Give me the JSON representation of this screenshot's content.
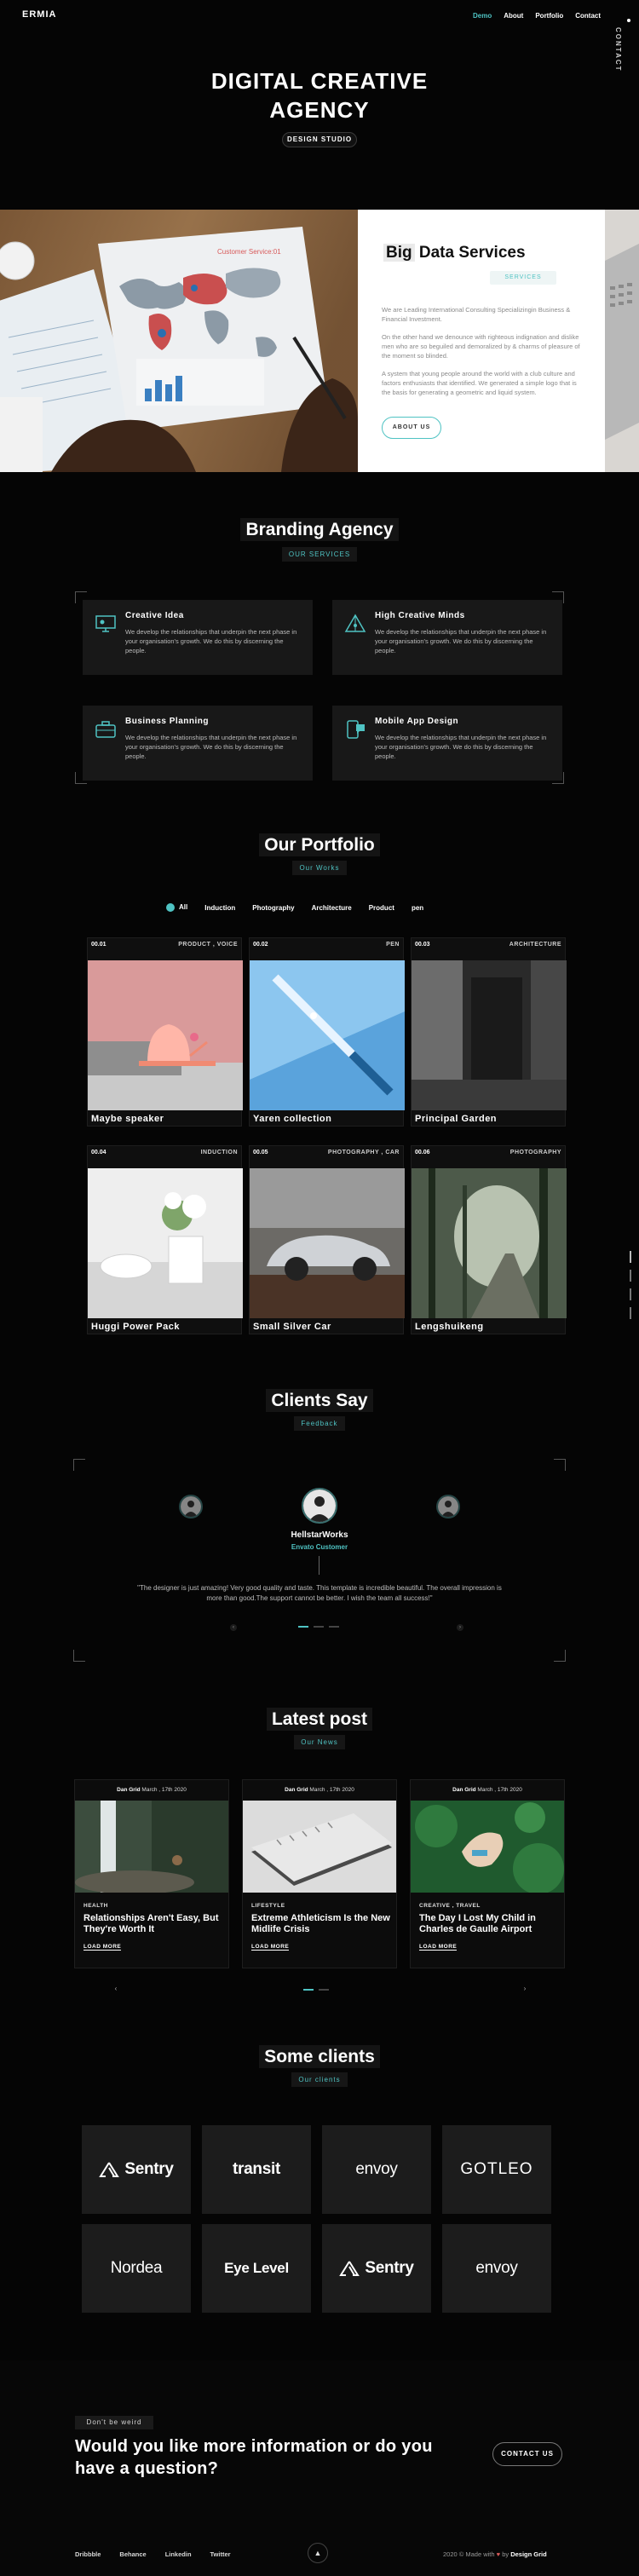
{
  "nav": {
    "logo": "ERMIA",
    "links": [
      "Demo",
      "About",
      "Portfolio",
      "Contact"
    ],
    "side_label": "CONTACT"
  },
  "hero": {
    "title_line1": "DIGITAL CREATIVE",
    "title_line2": "AGENCY",
    "badge": "DESIGN STUDIO"
  },
  "about": {
    "title_highlight": "Big",
    "title_rest": "Data Services",
    "tag": "SERVICES",
    "paragraphs": [
      "We are Leading International Consulting Specializingin Business & Financial Investment.",
      "On the other hand we denounce with righteous indignation and dislike men who are so beguiled and demoralized by & charms of pleasure of the moment so blinded.",
      "A system that young people around the world with a club culture and factors enthusiasts that identified. We generated a simple logo that is the basis for generating a geometric and liquid system."
    ],
    "button": "ABOUT US",
    "map_title": "Customer Service:01"
  },
  "services": {
    "title": "Branding Agency",
    "tag": "OUR SERVICES",
    "items": [
      {
        "title": "Creative Idea",
        "desc": "We develop the relationships that underpin the next phase in your organisation's growth. We do this by discerning the people."
      },
      {
        "title": "High Creative Minds",
        "desc": "We develop the relationships that underpin the next phase in your organisation's growth. We do this by discerning the people."
      },
      {
        "title": "Business Planning",
        "desc": "We develop the relationships that underpin the next phase in your organisation's growth. We do this by discerning the people."
      },
      {
        "title": "Mobile App Design",
        "desc": "We develop the relationships that underpin the next phase in your organisation's growth. We do this by discerning the people."
      }
    ]
  },
  "portfolio": {
    "title": "Our Portfolio",
    "tag": "Our Works",
    "filters": [
      "All",
      "Induction",
      "Photography",
      "Architecture",
      "Product",
      "pen"
    ],
    "items": [
      {
        "num": "00.01",
        "category": "PRODUCT , VOICE",
        "title": "Maybe speaker"
      },
      {
        "num": "00.02",
        "category": "PEN",
        "title": "Yaren collection"
      },
      {
        "num": "00.03",
        "category": "ARCHITECTURE",
        "title": "Principal Garden"
      },
      {
        "num": "00.04",
        "category": "INDUCTION",
        "title": "Huggi Power Pack"
      },
      {
        "num": "00.05",
        "category": "PHOTOGRAPHY , CAR",
        "title": "Small Silver Car"
      },
      {
        "num": "00.06",
        "category": "PHOTOGRAPHY",
        "title": "Lengshuikeng"
      }
    ]
  },
  "testimonials": {
    "title": "Clients Say",
    "tag": "Feedback",
    "name": "HellstarWorks",
    "role": "Envato Customer",
    "quote": "\"The designer is just amazing! Very good quality and taste. This template is incredible beautiful. The overall impression is more than good.The support cannot be better. I wish the team all success!\""
  },
  "blog": {
    "title": "Latest post",
    "tag": "Our News",
    "posts": [
      {
        "author": "Dan Grid",
        "date": "March , 17th 2020",
        "category": "HEALTH",
        "title": "Relationships Aren't Easy, But They're Worth It",
        "more": "LOAD MORE"
      },
      {
        "author": "Dan Grid",
        "date": "March , 17th 2020",
        "category": "LIFESTYLE",
        "title": "Extreme Athleticism Is the New Midlife Crisis",
        "more": "LOAD MORE"
      },
      {
        "author": "Dan Grid",
        "date": "March , 17th 2020",
        "category": "CREATIVE , TRAVEL",
        "title": "The Day I Lost My Child in Charles de Gaulle Airport",
        "more": "LOAD MORE"
      }
    ]
  },
  "clients": {
    "title": "Some clients",
    "tag": "Our clients",
    "logos": [
      "Sentry",
      "transit",
      "envoy",
      "GOTLEO",
      "Nordea",
      "Eye Level",
      "Sentry",
      "envoy"
    ]
  },
  "footer": {
    "cta_tag": "Don't be weird",
    "cta_title": "Would you like more information or do you have a question?",
    "cta_button": "CONTACT US",
    "links": [
      "Dribbble",
      "Behance",
      "Linkedin",
      "Twitter"
    ],
    "copyright": "2020 © Made with",
    "copyright_by": "by",
    "copyright_name": "Design Grid"
  },
  "colors": {
    "accent": "#4fc3c3",
    "background": "#050505",
    "card": "#181818"
  }
}
